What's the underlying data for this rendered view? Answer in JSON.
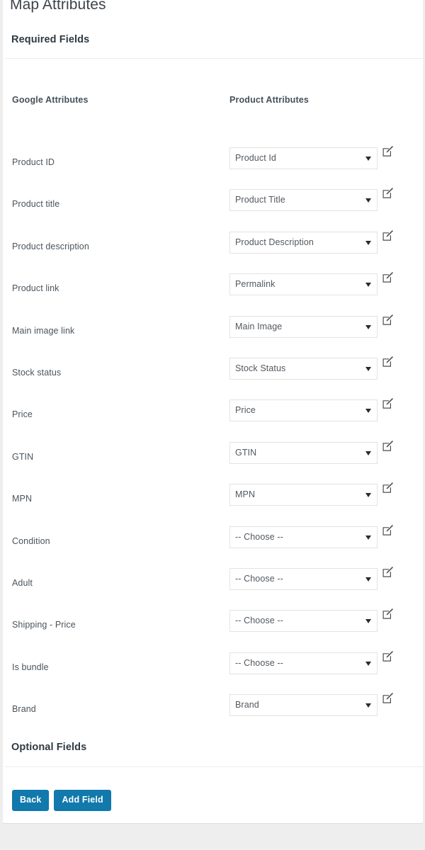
{
  "page": {
    "title": "Map Attributes",
    "background_color": "#eeeeee",
    "card_color": "#ffffff"
  },
  "sections": {
    "required_label": "Required Fields",
    "optional_label": "Optional Fields"
  },
  "table": {
    "headers": {
      "google": "Google Attributes",
      "product": "Product Attributes"
    },
    "rows": [
      {
        "google_attribute": "Product ID",
        "product_attribute": "Product Id",
        "edit_icon": "edit-pencil-square-icon"
      },
      {
        "google_attribute": "Product title",
        "product_attribute": "Product Title",
        "edit_icon": "edit-pencil-square-icon"
      },
      {
        "google_attribute": "Product description",
        "product_attribute": "Product Description",
        "edit_icon": "edit-pencil-square-icon"
      },
      {
        "google_attribute": "Product link",
        "product_attribute": "Permalink",
        "edit_icon": "edit-pencil-square-icon"
      },
      {
        "google_attribute": "Main image link",
        "product_attribute": "Main Image",
        "edit_icon": "edit-pencil-square-icon"
      },
      {
        "google_attribute": "Stock status",
        "product_attribute": "Stock Status",
        "edit_icon": "edit-pencil-square-icon"
      },
      {
        "google_attribute": "Price",
        "product_attribute": "Price",
        "edit_icon": "edit-pencil-square-icon"
      },
      {
        "google_attribute": "GTIN",
        "product_attribute": "GTIN",
        "edit_icon": "edit-pencil-square-icon"
      },
      {
        "google_attribute": "MPN",
        "product_attribute": "MPN",
        "edit_icon": "edit-pencil-square-icon"
      },
      {
        "google_attribute": "Condition",
        "product_attribute": "-- Choose --",
        "edit_icon": "edit-pencil-square-icon"
      },
      {
        "google_attribute": "Adult",
        "product_attribute": "-- Choose --",
        "edit_icon": "edit-pencil-square-icon"
      },
      {
        "google_attribute": "Shipping - Price",
        "product_attribute": "-- Choose --",
        "edit_icon": "edit-pencil-square-icon"
      },
      {
        "google_attribute": "Is bundle",
        "product_attribute": "-- Choose --",
        "edit_icon": "edit-pencil-square-icon"
      },
      {
        "google_attribute": "Brand",
        "product_attribute": "Brand",
        "edit_icon": "edit-pencil-square-icon"
      }
    ]
  },
  "footer": {
    "buttons": [
      {
        "label": "Back",
        "name": "back-button",
        "color": "#1179ab"
      },
      {
        "label": "Add Field",
        "name": "add-field-button",
        "color": "#1179ab"
      }
    ]
  }
}
